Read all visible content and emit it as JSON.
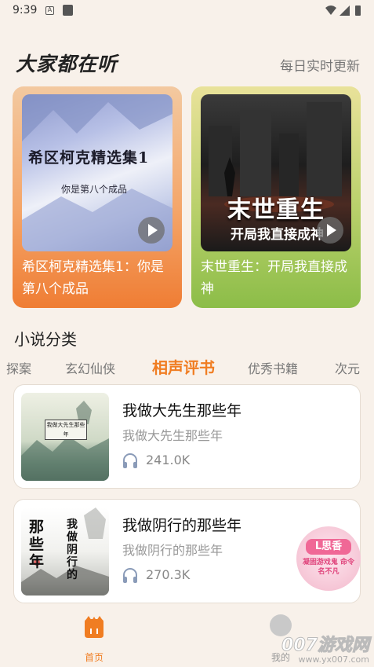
{
  "status_bar": {
    "time": "9:39",
    "notif_letter": "A"
  },
  "featured": {
    "title": "大家都在听",
    "subtitle": "每日实时更新",
    "items": [
      {
        "cover_title": "希区柯克精选集1",
        "cover_sub": "你是第八个成品",
        "caption": "希区柯克精选集1：你是第八个成品"
      },
      {
        "cover_title": "末世重生",
        "cover_sub": "开局我直接成神",
        "caption": "末世重生：开局我直接成神"
      }
    ]
  },
  "categories": {
    "title": "小说分类",
    "tabs": [
      "探案",
      "玄幻仙侠",
      "相声评书",
      "优秀书籍",
      "次元"
    ],
    "active_tab": "相声评书"
  },
  "books": [
    {
      "title": "我做大先生那些年",
      "subtitle": "我做大先生那些年",
      "listens": "241.0K",
      "cover_text": "我做大先生那些年"
    },
    {
      "title": "我做阴行的那些年",
      "subtitle": "我做阴行的那些年",
      "listens": "270.3K",
      "cover_text_left": "那些年",
      "cover_text_right": "我做阴行的"
    }
  ],
  "promo": {
    "line1": "L思香",
    "line2": "凝固游戏鬼 命令名不凡"
  },
  "nav": {
    "home_label": "首页",
    "mine_label": "我的"
  },
  "watermark": {
    "main": "007游戏网",
    "url": "www.yx007.com"
  },
  "colors": {
    "accent": "#f07d22",
    "background": "#f8f1ea"
  }
}
